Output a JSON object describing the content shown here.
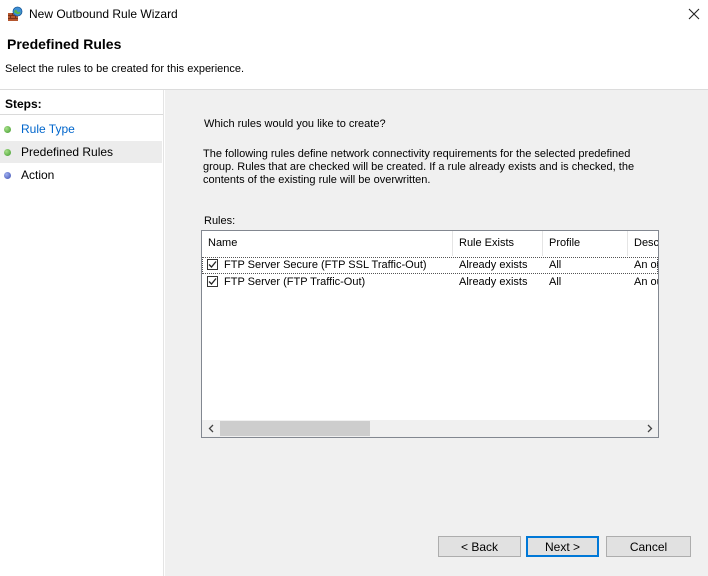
{
  "window": {
    "title": "New Outbound Rule Wizard",
    "icon": "firewall-wizard-icon"
  },
  "header": {
    "title": "Predefined Rules",
    "subtitle": "Select the rules to be created for this experience."
  },
  "steps": {
    "heading": "Steps:",
    "items": [
      {
        "label": "Rule Type",
        "state": "completed",
        "link": true,
        "dot_color": "#5cb85c"
      },
      {
        "label": "Predefined Rules",
        "state": "current",
        "link": false,
        "dot_color": "#5cb85c"
      },
      {
        "label": "Action",
        "state": "pending",
        "link": false,
        "dot_color": "#5a6fc8"
      }
    ]
  },
  "content": {
    "question": "Which rules would you like to create?",
    "explanation": "The following rules define network connectivity requirements for the selected predefined group. Rules that are checked will be created. If a rule already exists and is checked, the contents of the existing rule will be overwritten.",
    "rules_label": "Rules:"
  },
  "rules_table": {
    "columns": [
      "Name",
      "Rule Exists",
      "Profile",
      "Desc"
    ],
    "rows": [
      {
        "checked": true,
        "name": "FTP Server Secure (FTP SSL Traffic-Out)",
        "rule_exists": "Already exists",
        "profile": "All",
        "description": "An ou"
      },
      {
        "checked": true,
        "name": "FTP Server (FTP Traffic-Out)",
        "rule_exists": "Already exists",
        "profile": "All",
        "description": "An ou"
      }
    ]
  },
  "buttons": {
    "back": "< Back",
    "next": "Next >",
    "cancel": "Cancel"
  },
  "colors": {
    "link": "#0066cc",
    "default_button_border": "#0078d7",
    "content_background": "#f0f0f0"
  }
}
